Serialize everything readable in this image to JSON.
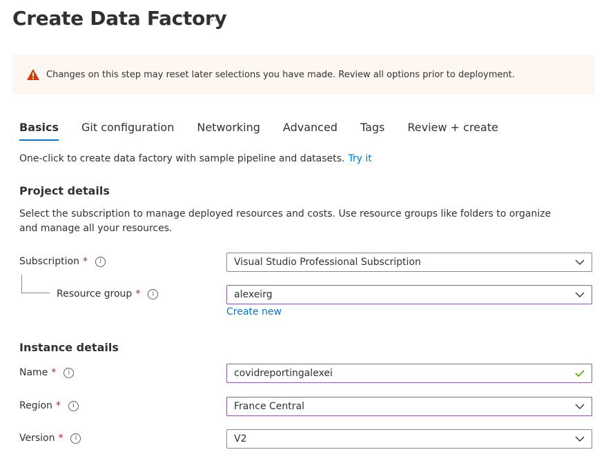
{
  "header": {
    "title": "Create Data Factory",
    "more_label": "···"
  },
  "warning": {
    "text": "Changes on this step may reset later selections you have made. Review all options prior to deployment.",
    "color": "#d83b01"
  },
  "tabs": [
    {
      "label": "Basics",
      "active": true
    },
    {
      "label": "Git configuration",
      "active": false
    },
    {
      "label": "Networking",
      "active": false
    },
    {
      "label": "Advanced",
      "active": false
    },
    {
      "label": "Tags",
      "active": false
    },
    {
      "label": "Review + create",
      "active": false
    }
  ],
  "intro": {
    "text": "One-click to create data factory with sample pipeline and datasets.",
    "link": "Try it"
  },
  "project": {
    "title": "Project details",
    "description": "Select the subscription to manage deployed resources and costs. Use resource groups like folders to organize and manage all your resources.",
    "subscription": {
      "label": "Subscription",
      "required": "*",
      "value": "Visual Studio Professional Subscription"
    },
    "resource_group": {
      "label": "Resource group",
      "required": "*",
      "value": "alexeirg",
      "create_new": "Create new"
    }
  },
  "instance": {
    "title": "Instance details",
    "name": {
      "label": "Name",
      "required": "*",
      "value": "covidreportingalexei"
    },
    "region": {
      "label": "Region",
      "required": "*",
      "value": "France Central"
    },
    "version": {
      "label": "Version",
      "required": "*",
      "value": "V2"
    }
  },
  "colors": {
    "accent": "#0078d4",
    "required": "#a4262c",
    "valid": "#57a300",
    "focus_border": "#8a57a8"
  }
}
